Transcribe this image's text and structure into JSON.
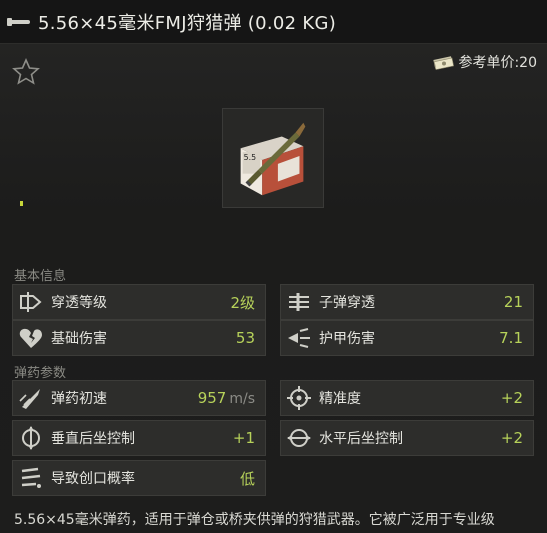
{
  "title": "5.56×45毫米FMJ狩猎弹 (0.02 KG)",
  "reference_price": "参考单价:20",
  "sections": {
    "basic": "基本信息",
    "ammo": "弹药参数"
  },
  "stats": [
    {
      "icon": "penetration-level-icon",
      "label": "穿透等级",
      "value": "2级",
      "unit": "",
      "color": "green"
    },
    {
      "icon": "bullet-penetration-icon",
      "label": "子弹穿透",
      "value": "21",
      "unit": "",
      "color": "green"
    },
    {
      "icon": "broken-heart-icon",
      "label": "基础伤害",
      "value": "53",
      "unit": "",
      "color": "green"
    },
    {
      "icon": "armor-damage-icon",
      "label": "护甲伤害",
      "value": "7.1",
      "unit": "",
      "color": "green"
    },
    {
      "icon": "muzzle-velocity-icon",
      "label": "弹药初速",
      "value": "957",
      "unit": "m/s",
      "color": "green"
    },
    {
      "icon": "crosshair-icon",
      "label": "精准度",
      "value": "+2",
      "unit": "",
      "color": "green"
    },
    {
      "icon": "vertical-recoil-icon",
      "label": "垂直后坐控制",
      "value": "+1",
      "unit": "",
      "color": "green"
    },
    {
      "icon": "horizontal-recoil-icon",
      "label": "水平后坐控制",
      "value": "+2",
      "unit": "",
      "color": "green"
    },
    {
      "icon": "bleeding-icon",
      "label": "导致创口概率",
      "value": "低",
      "unit": "",
      "color": "green"
    }
  ],
  "description": "5.56×45毫米弹药，适用于弹仓或桥夹供弹的狩猎武器。它被广泛用于专业级",
  "colors": {
    "accent_green": "#b7d25a",
    "background": "#1f1f1e",
    "panel": "#2d2d2b"
  }
}
